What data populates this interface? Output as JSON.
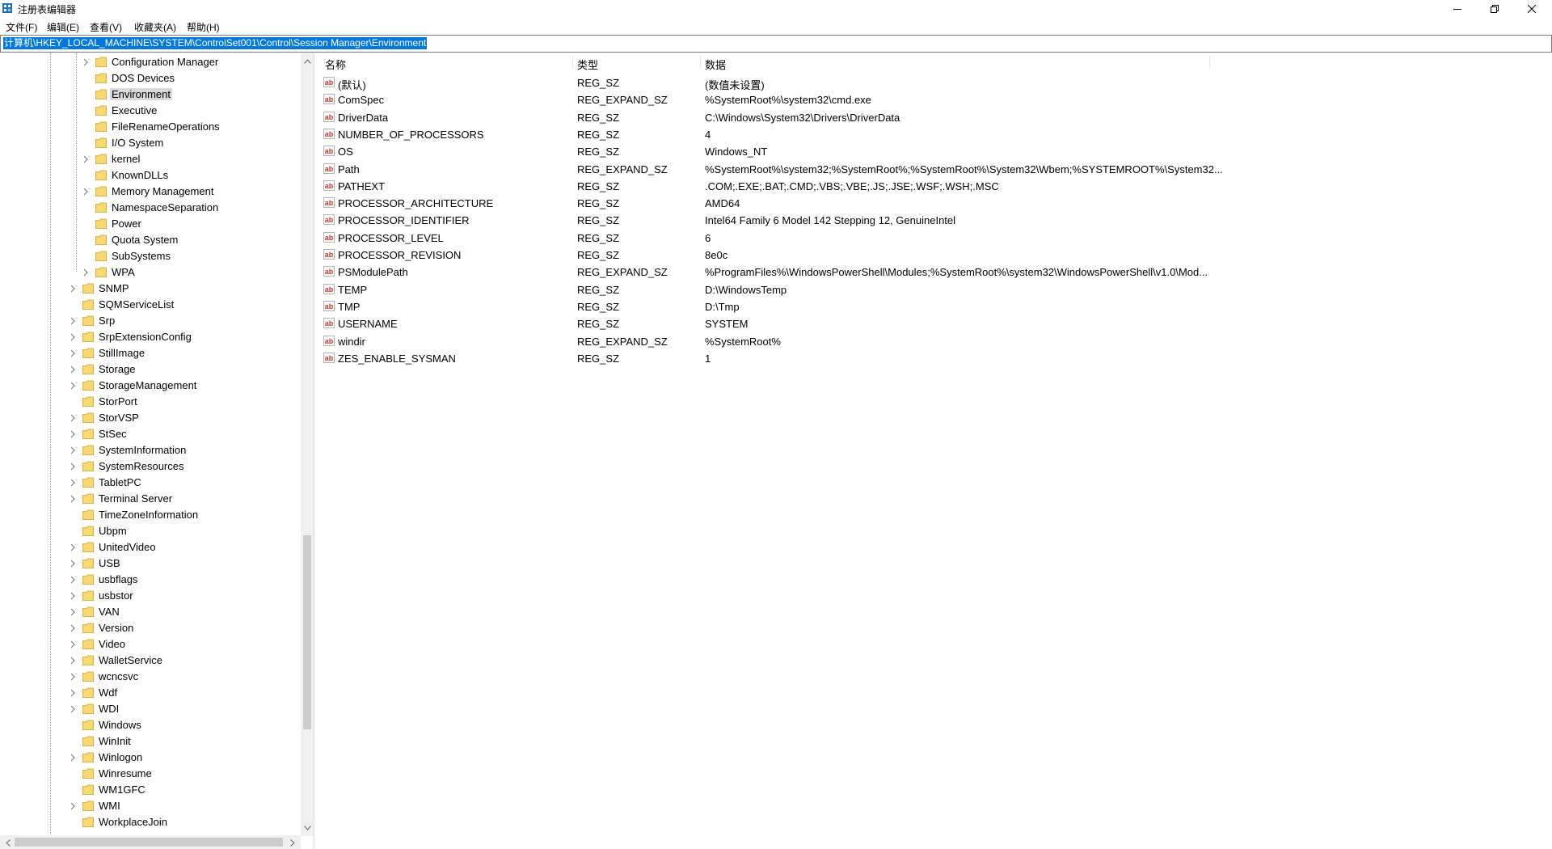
{
  "window": {
    "title": "注册表编辑器",
    "controls": [
      "minimize-icon",
      "restore-icon",
      "close-icon"
    ]
  },
  "menu": [
    {
      "label": "文件(F)"
    },
    {
      "label": "编辑(E)"
    },
    {
      "label": "查看(V)"
    },
    {
      "label": "收藏夹(A)"
    },
    {
      "label": "帮助(H)"
    }
  ],
  "address": "计算机\\HKEY_LOCAL_MACHINE\\SYSTEM\\ControlSet001\\Control\\Session Manager\\Environment",
  "tree": [
    {
      "label": "Configuration Manager",
      "level": 2,
      "expandable": true,
      "selected": false
    },
    {
      "label": "DOS Devices",
      "level": 2,
      "expandable": false,
      "selected": false
    },
    {
      "label": "Environment",
      "level": 2,
      "expandable": false,
      "selected": true
    },
    {
      "label": "Executive",
      "level": 2,
      "expandable": false,
      "selected": false
    },
    {
      "label": "FileRenameOperations",
      "level": 2,
      "expandable": false,
      "selected": false
    },
    {
      "label": "I/O System",
      "level": 2,
      "expandable": false,
      "selected": false
    },
    {
      "label": "kernel",
      "level": 2,
      "expandable": true,
      "selected": false
    },
    {
      "label": "KnownDLLs",
      "level": 2,
      "expandable": false,
      "selected": false
    },
    {
      "label": "Memory Management",
      "level": 2,
      "expandable": true,
      "selected": false
    },
    {
      "label": "NamespaceSeparation",
      "level": 2,
      "expandable": false,
      "selected": false
    },
    {
      "label": "Power",
      "level": 2,
      "expandable": false,
      "selected": false
    },
    {
      "label": "Quota System",
      "level": 2,
      "expandable": false,
      "selected": false
    },
    {
      "label": "SubSystems",
      "level": 2,
      "expandable": false,
      "selected": false
    },
    {
      "label": "WPA",
      "level": 2,
      "expandable": true,
      "selected": false
    },
    {
      "label": "SNMP",
      "level": 1,
      "expandable": true,
      "selected": false
    },
    {
      "label": "SQMServiceList",
      "level": 1,
      "expandable": false,
      "selected": false
    },
    {
      "label": "Srp",
      "level": 1,
      "expandable": true,
      "selected": false
    },
    {
      "label": "SrpExtensionConfig",
      "level": 1,
      "expandable": true,
      "selected": false
    },
    {
      "label": "StillImage",
      "level": 1,
      "expandable": true,
      "selected": false
    },
    {
      "label": "Storage",
      "level": 1,
      "expandable": true,
      "selected": false
    },
    {
      "label": "StorageManagement",
      "level": 1,
      "expandable": true,
      "selected": false
    },
    {
      "label": "StorPort",
      "level": 1,
      "expandable": false,
      "selected": false
    },
    {
      "label": "StorVSP",
      "level": 1,
      "expandable": true,
      "selected": false
    },
    {
      "label": "StSec",
      "level": 1,
      "expandable": true,
      "selected": false
    },
    {
      "label": "SystemInformation",
      "level": 1,
      "expandable": true,
      "selected": false
    },
    {
      "label": "SystemResources",
      "level": 1,
      "expandable": true,
      "selected": false
    },
    {
      "label": "TabletPC",
      "level": 1,
      "expandable": true,
      "selected": false
    },
    {
      "label": "Terminal Server",
      "level": 1,
      "expandable": true,
      "selected": false
    },
    {
      "label": "TimeZoneInformation",
      "level": 1,
      "expandable": false,
      "selected": false
    },
    {
      "label": "Ubpm",
      "level": 1,
      "expandable": false,
      "selected": false
    },
    {
      "label": "UnitedVideo",
      "level": 1,
      "expandable": true,
      "selected": false
    },
    {
      "label": "USB",
      "level": 1,
      "expandable": true,
      "selected": false
    },
    {
      "label": "usbflags",
      "level": 1,
      "expandable": true,
      "selected": false
    },
    {
      "label": "usbstor",
      "level": 1,
      "expandable": true,
      "selected": false
    },
    {
      "label": "VAN",
      "level": 1,
      "expandable": true,
      "selected": false
    },
    {
      "label": "Version",
      "level": 1,
      "expandable": true,
      "selected": false
    },
    {
      "label": "Video",
      "level": 1,
      "expandable": true,
      "selected": false
    },
    {
      "label": "WalletService",
      "level": 1,
      "expandable": true,
      "selected": false
    },
    {
      "label": "wcncsvc",
      "level": 1,
      "expandable": true,
      "selected": false
    },
    {
      "label": "Wdf",
      "level": 1,
      "expandable": true,
      "selected": false
    },
    {
      "label": "WDI",
      "level": 1,
      "expandable": true,
      "selected": false
    },
    {
      "label": "Windows",
      "level": 1,
      "expandable": false,
      "selected": false
    },
    {
      "label": "WinInit",
      "level": 1,
      "expandable": false,
      "selected": false
    },
    {
      "label": "Winlogon",
      "level": 1,
      "expandable": true,
      "selected": false
    },
    {
      "label": "Winresume",
      "level": 1,
      "expandable": false,
      "selected": false
    },
    {
      "label": "WM1GFC",
      "level": 1,
      "expandable": false,
      "selected": false
    },
    {
      "label": "WMI",
      "level": 1,
      "expandable": true,
      "selected": false
    },
    {
      "label": "WorkplaceJoin",
      "level": 1,
      "expandable": false,
      "selected": false
    }
  ],
  "list": {
    "headers": {
      "name": "名称",
      "type": "类型",
      "data": "数据"
    },
    "rows": [
      {
        "name": "(默认)",
        "type": "REG_SZ",
        "data": "(数值未设置)"
      },
      {
        "name": "ComSpec",
        "type": "REG_EXPAND_SZ",
        "data": "%SystemRoot%\\system32\\cmd.exe"
      },
      {
        "name": "DriverData",
        "type": "REG_SZ",
        "data": "C:\\Windows\\System32\\Drivers\\DriverData"
      },
      {
        "name": "NUMBER_OF_PROCESSORS",
        "type": "REG_SZ",
        "data": "4"
      },
      {
        "name": "OS",
        "type": "REG_SZ",
        "data": "Windows_NT"
      },
      {
        "name": "Path",
        "type": "REG_EXPAND_SZ",
        "data": "%SystemRoot%\\system32;%SystemRoot%;%SystemRoot%\\System32\\Wbem;%SYSTEMROOT%\\System32..."
      },
      {
        "name": "PATHEXT",
        "type": "REG_SZ",
        "data": ".COM;.EXE;.BAT;.CMD;.VBS;.VBE;.JS;.JSE;.WSF;.WSH;.MSC"
      },
      {
        "name": "PROCESSOR_ARCHITECTURE",
        "type": "REG_SZ",
        "data": "AMD64"
      },
      {
        "name": "PROCESSOR_IDENTIFIER",
        "type": "REG_SZ",
        "data": "Intel64 Family 6 Model 142 Stepping 12, GenuineIntel"
      },
      {
        "name": "PROCESSOR_LEVEL",
        "type": "REG_SZ",
        "data": "6"
      },
      {
        "name": "PROCESSOR_REVISION",
        "type": "REG_SZ",
        "data": "8e0c"
      },
      {
        "name": "PSModulePath",
        "type": "REG_EXPAND_SZ",
        "data": "%ProgramFiles%\\WindowsPowerShell\\Modules;%SystemRoot%\\system32\\WindowsPowerShell\\v1.0\\Mod..."
      },
      {
        "name": "TEMP",
        "type": "REG_SZ",
        "data": "D:\\WindowsTemp"
      },
      {
        "name": "TMP",
        "type": "REG_SZ",
        "data": "D:\\Tmp"
      },
      {
        "name": "USERNAME",
        "type": "REG_SZ",
        "data": "SYSTEM"
      },
      {
        "name": "windir",
        "type": "REG_EXPAND_SZ",
        "data": "%SystemRoot%"
      },
      {
        "name": "ZES_ENABLE_SYSMAN",
        "type": "REG_SZ",
        "data": "1"
      }
    ]
  },
  "colors": {
    "selection": "#0078d7",
    "folder": "#f8d775",
    "selected_tree_bg": "#d9d9d9"
  }
}
